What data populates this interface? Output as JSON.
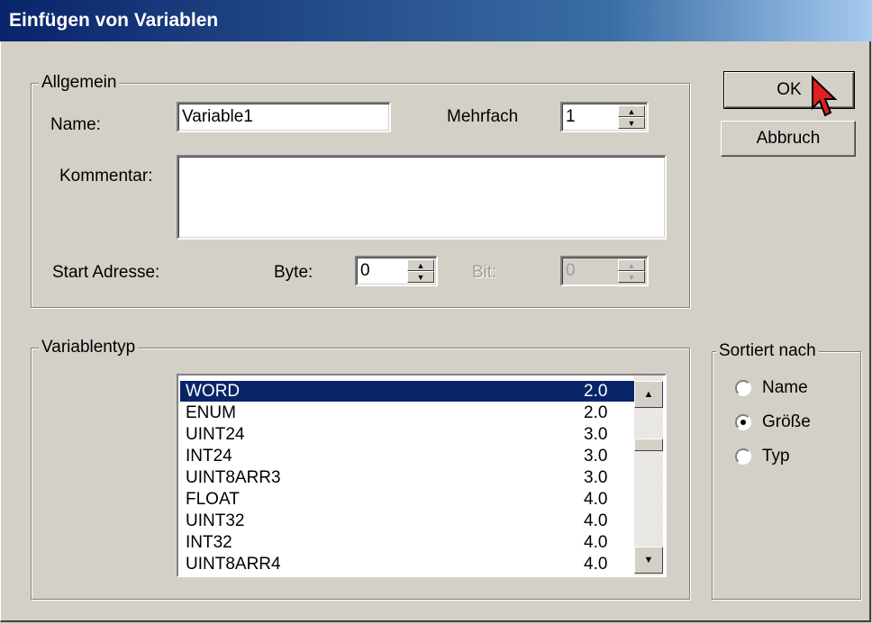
{
  "window": {
    "title": "Einfügen von Variablen"
  },
  "buttons": {
    "ok": "OK",
    "cancel": "Abbruch"
  },
  "general": {
    "legend": "Allgemein",
    "name_label": "Name:",
    "name_value": "Variable1",
    "multiple_label": "Mehrfach",
    "multiple_value": "1",
    "comment_label": "Kommentar:",
    "comment_value": "",
    "start_address_label": "Start Adresse:",
    "byte_label": "Byte:",
    "byte_value": "0",
    "bit_label": "Bit:",
    "bit_value": "0"
  },
  "variable_type": {
    "legend": "Variablentyp",
    "items": [
      {
        "name": "WORD",
        "size": "2.0",
        "selected": true
      },
      {
        "name": "ENUM",
        "size": "2.0"
      },
      {
        "name": "UINT24",
        "size": "3.0"
      },
      {
        "name": "INT24",
        "size": "3.0"
      },
      {
        "name": "UINT8ARR3",
        "size": "3.0"
      },
      {
        "name": "FLOAT",
        "size": "4.0"
      },
      {
        "name": "UINT32",
        "size": "4.0"
      },
      {
        "name": "INT32",
        "size": "4.0"
      },
      {
        "name": "UINT8ARR4",
        "size": "4.0"
      }
    ]
  },
  "sort": {
    "legend": "Sortiert nach",
    "options": [
      {
        "label": "Name",
        "checked": false
      },
      {
        "label": "Größe",
        "checked": true
      },
      {
        "label": "Typ",
        "checked": false
      }
    ]
  },
  "icons": {
    "cursor": "mouse-pointer-icon",
    "spin": "spin-arrows-icon",
    "scroll": "scroll-arrow-icon"
  },
  "colors": {
    "title_start": "#0a246a",
    "title_end": "#a6caf0",
    "selection": "#0a246a",
    "face": "#d4d0c8"
  }
}
